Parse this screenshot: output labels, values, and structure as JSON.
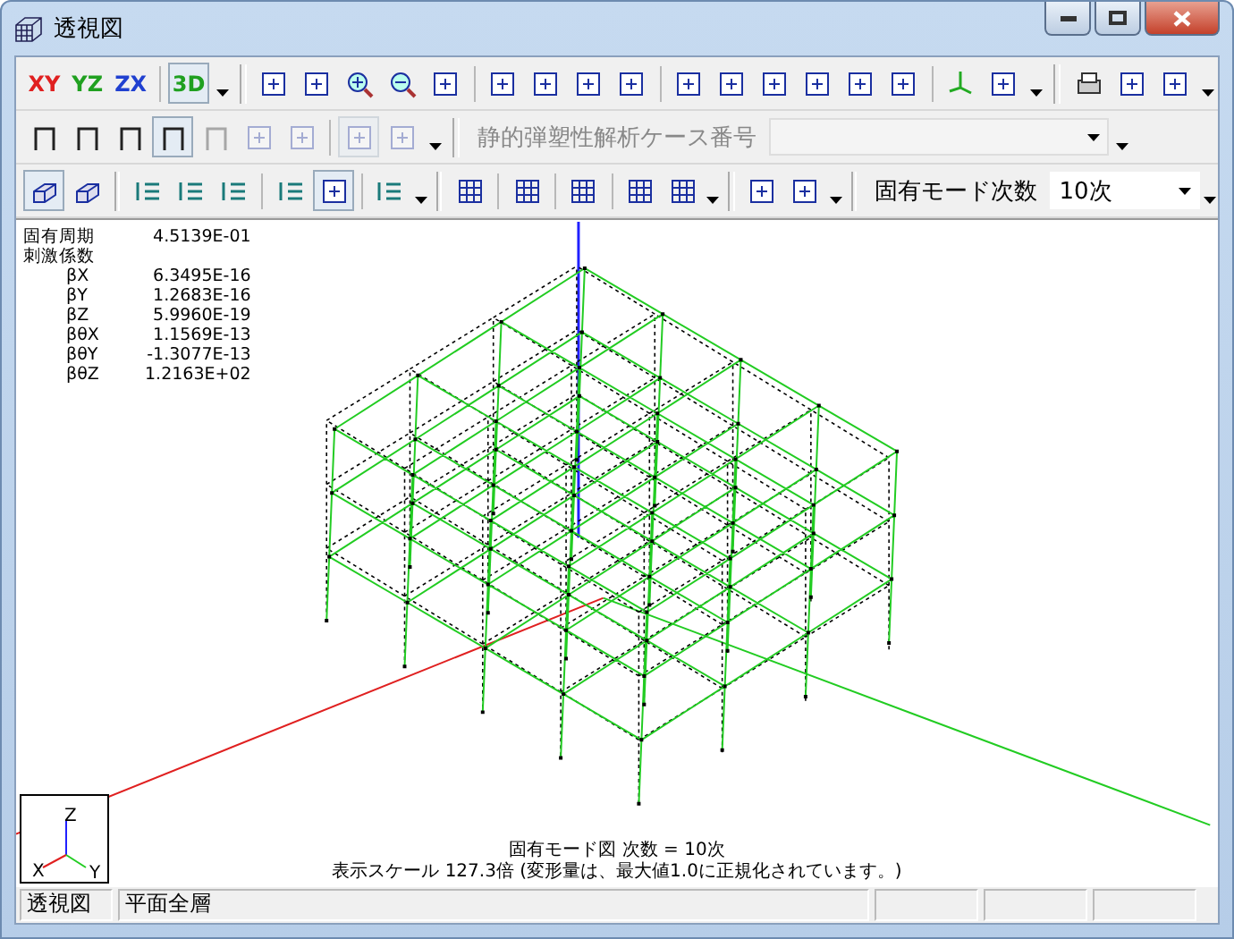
{
  "window": {
    "title": "透視図"
  },
  "toolbars": [
    [
      {
        "kind": "text",
        "label": "XY",
        "color": "#e02020"
      },
      {
        "kind": "text",
        "label": "YZ",
        "color": "#20a020"
      },
      {
        "kind": "text",
        "label": "ZX",
        "color": "#2040d0"
      },
      {
        "kind": "sep"
      },
      {
        "kind": "text",
        "label": "3D",
        "color": "#20a020",
        "pressed": true
      },
      {
        "kind": "caret"
      },
      {
        "kind": "bar"
      },
      {
        "kind": "icon",
        "pressed": false,
        "disabled": false
      },
      {
        "kind": "icon",
        "pressed": false,
        "disabled": false
      },
      {
        "kind": "icon",
        "pressed": false,
        "disabled": false
      },
      {
        "kind": "icon",
        "pressed": false,
        "disabled": false
      },
      {
        "kind": "icon",
        "pressed": false,
        "disabled": false
      },
      {
        "kind": "sep"
      },
      {
        "kind": "icon",
        "pressed": false,
        "disabled": false
      },
      {
        "kind": "icon",
        "pressed": false,
        "disabled": false
      },
      {
        "kind": "icon",
        "pressed": false,
        "disabled": false
      },
      {
        "kind": "icon",
        "pressed": false,
        "disabled": false
      },
      {
        "kind": "sep"
      },
      {
        "kind": "icon",
        "pressed": false,
        "disabled": false
      },
      {
        "kind": "icon",
        "pressed": false,
        "disabled": false
      },
      {
        "kind": "icon",
        "pressed": false,
        "disabled": false
      },
      {
        "kind": "icon",
        "pressed": false,
        "disabled": false
      },
      {
        "kind": "icon",
        "pressed": false,
        "disabled": false
      },
      {
        "kind": "icon",
        "pressed": false,
        "disabled": false
      },
      {
        "kind": "sep"
      },
      {
        "kind": "icon",
        "pressed": false,
        "disabled": false
      },
      {
        "kind": "icon",
        "pressed": false,
        "disabled": false
      },
      {
        "kind": "caret"
      },
      {
        "kind": "bar"
      },
      {
        "kind": "icon",
        "pressed": false,
        "disabled": false
      },
      {
        "kind": "icon",
        "pressed": false,
        "disabled": false
      },
      {
        "kind": "icon",
        "pressed": false,
        "disabled": false
      },
      {
        "kind": "caret"
      }
    ],
    [
      {
        "kind": "icon",
        "pressed": false,
        "disabled": false
      },
      {
        "kind": "icon",
        "pressed": false,
        "disabled": false
      },
      {
        "kind": "icon",
        "pressed": false,
        "disabled": false
      },
      {
        "kind": "icon",
        "pressed": true,
        "disabled": false
      },
      {
        "kind": "icon",
        "pressed": false,
        "disabled": true
      },
      {
        "kind": "icon",
        "pressed": false,
        "disabled": true
      },
      {
        "kind": "icon",
        "pressed": false,
        "disabled": true
      },
      {
        "kind": "sep"
      },
      {
        "kind": "icon",
        "pressed": true,
        "disabled": true
      },
      {
        "kind": "icon",
        "pressed": false,
        "disabled": true
      },
      {
        "kind": "caret"
      },
      {
        "kind": "bar"
      },
      {
        "kind": "combo",
        "label": "静的弾塑性解析ケース番号",
        "disabled": true
      },
      {
        "kind": "caret"
      }
    ],
    [
      {
        "kind": "icon",
        "pressed": true,
        "disabled": false
      },
      {
        "kind": "icon",
        "pressed": false,
        "disabled": false
      },
      {
        "kind": "bar"
      },
      {
        "kind": "icon",
        "pressed": false,
        "disabled": false
      },
      {
        "kind": "icon",
        "pressed": false,
        "disabled": false
      },
      {
        "kind": "icon",
        "pressed": false,
        "disabled": false
      },
      {
        "kind": "sep"
      },
      {
        "kind": "icon",
        "pressed": false,
        "disabled": false
      },
      {
        "kind": "icon",
        "pressed": true,
        "disabled": false
      },
      {
        "kind": "sep"
      },
      {
        "kind": "icon",
        "pressed": false,
        "disabled": false
      },
      {
        "kind": "caret"
      },
      {
        "kind": "bar"
      },
      {
        "kind": "icon",
        "pressed": false,
        "disabled": false
      },
      {
        "kind": "sep"
      },
      {
        "kind": "icon",
        "pressed": false,
        "disabled": false
      },
      {
        "kind": "sep"
      },
      {
        "kind": "icon",
        "pressed": false,
        "disabled": false
      },
      {
        "kind": "sep"
      },
      {
        "kind": "icon",
        "pressed": false,
        "disabled": false
      },
      {
        "kind": "icon",
        "pressed": false,
        "disabled": false
      },
      {
        "kind": "caret"
      },
      {
        "kind": "bar"
      },
      {
        "kind": "icon",
        "pressed": false,
        "disabled": false
      },
      {
        "kind": "icon",
        "pressed": false,
        "disabled": false
      },
      {
        "kind": "caret"
      },
      {
        "kind": "bar"
      },
      {
        "kind": "combo",
        "label": "固有モード次数",
        "value": "10次",
        "disabled": false
      },
      {
        "kind": "caret"
      }
    ]
  ],
  "info": [
    {
      "label": "固有周期",
      "value": "4.5139E-01",
      "indent": false
    },
    {
      "label": "刺激係数",
      "indent": false
    },
    {
      "label": "βX",
      "value": "6.3495E-16",
      "indent": true
    },
    {
      "label": "βY",
      "value": "1.2683E-16",
      "indent": true
    },
    {
      "label": "βZ",
      "value": "5.9960E-19",
      "indent": true
    },
    {
      "label": "βθX",
      "value": "1.1569E-13",
      "indent": true
    },
    {
      "label": "βθY",
      "value": "-1.3077E-13",
      "indent": true
    },
    {
      "label": "βθZ",
      "value": "1.2163E+02",
      "indent": true
    }
  ],
  "caption": [
    "固有モード図 次数 = 10次",
    "表示スケール 127.3倍 (変形量は、最大値1.0に正規化されています。)"
  ],
  "axis_labels": {
    "z": "Z",
    "x": "X",
    "y": "Y"
  },
  "status_bar": [
    "透視図",
    "平面全層"
  ]
}
